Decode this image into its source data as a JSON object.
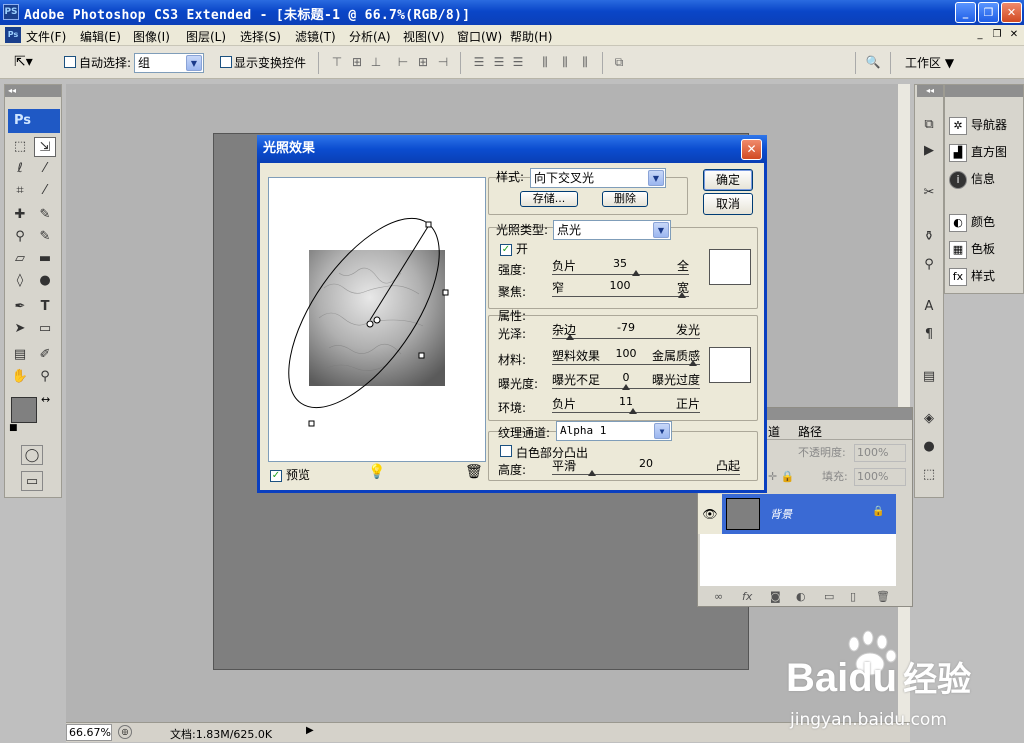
{
  "app": {
    "title": "Adobe Photoshop CS3 Extended - [未标题-1 @ 66.7%(RGB/8)]",
    "icon": "PS"
  },
  "menu": {
    "items": [
      "文件(F)",
      "编辑(E)",
      "图像(I)",
      "图层(L)",
      "选择(S)",
      "滤镜(T)",
      "分析(A)",
      "视图(V)",
      "窗口(W)",
      "帮助(H)"
    ]
  },
  "options": {
    "auto_select_label": "自动选择:",
    "auto_select_value": "组",
    "show_transform_label": "显示变换控件",
    "workspace_label": "工作区"
  },
  "panels": {
    "right_items": [
      "导航器",
      "直方图",
      "信息",
      "颜色",
      "色板",
      "样式"
    ]
  },
  "layers": {
    "tabs": [
      "道",
      "路径"
    ],
    "opacity_label": "不透明度:",
    "opacity_value": "100%",
    "fill_label": "填充:",
    "fill_value": "100%",
    "layer_name": "背景"
  },
  "status": {
    "zoom": "66.67%",
    "doc_info": "文档:1.83M/625.0K"
  },
  "dialog": {
    "title": "光照效果",
    "style_label": "样式:",
    "style_value": "向下交叉光",
    "save_label": "存储...",
    "delete_label": "删除",
    "ok_label": "确定",
    "cancel_label": "取消",
    "light_type_label": "光照类型:",
    "light_type_value": "点光",
    "on_label": "开",
    "intensity": {
      "label": "强度:",
      "lo": "负片",
      "value": "35",
      "hi": "全",
      "pos": 0.62
    },
    "focus": {
      "label": "聚焦:",
      "lo": "窄",
      "value": "100",
      "hi": "宽",
      "pos": 0.98
    },
    "properties_label": "属性:",
    "gloss": {
      "label": "光泽:",
      "lo": "杂边",
      "value": "-79",
      "hi": "发光",
      "pos": 0.1
    },
    "material": {
      "label": "材料:",
      "lo": "塑料效果",
      "value": "100",
      "hi": "金属质感",
      "pos": 0.98
    },
    "exposure": {
      "label": "曝光度:",
      "lo": "曝光不足",
      "value": "0",
      "hi": "曝光过度",
      "pos": 0.5
    },
    "ambience": {
      "label": "环境:",
      "lo": "负片",
      "value": "11",
      "hi": "正片",
      "pos": 0.55
    },
    "texture_label": "纹理通道:",
    "texture_value": "Alpha 1",
    "white_high_label": "白色部分凸出",
    "height": {
      "label": "高度:",
      "lo": "平滑",
      "value": "20",
      "hi": "凸起",
      "pos": 0.2
    },
    "preview_label": "预览"
  },
  "watermark": {
    "brand": "Baidu",
    "cn": "经验",
    "url": "jingyan.baidu.com"
  }
}
